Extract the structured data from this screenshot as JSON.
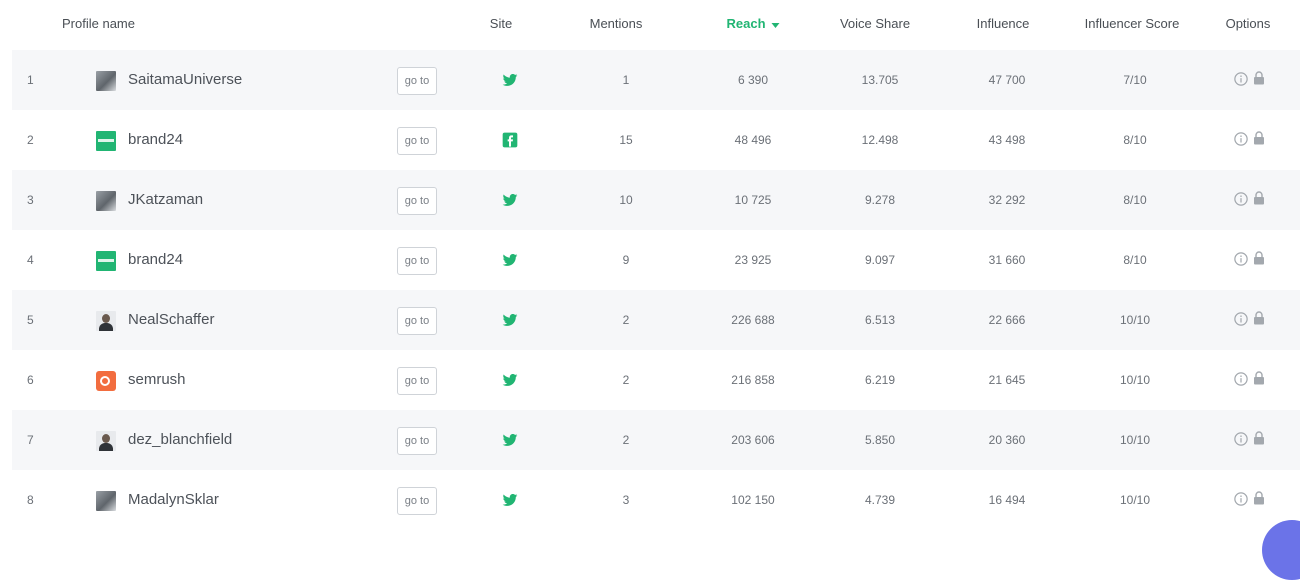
{
  "header": {
    "profile_name": "Profile name",
    "site": "Site",
    "mentions": "Mentions",
    "reach": "Reach",
    "voice_share": "Voice Share",
    "influence": "Influence",
    "influencer_score": "Influencer Score",
    "options": "Options"
  },
  "sorted_column": "reach",
  "sort_direction": "descending",
  "colors": {
    "accent": "#21b573",
    "twitter_icon": "#21b573",
    "row_alt": "#f6f7f9"
  },
  "go_to_label": "go to",
  "rows": [
    {
      "index": "1",
      "profile": "SaitamaUniverse",
      "avatar": "photo",
      "site": "twitter-icon",
      "mentions": "1",
      "reach": "6 390",
      "voice_share": "13.705",
      "influence": "47 700",
      "score": "7/10"
    },
    {
      "index": "2",
      "profile": "brand24",
      "avatar": "brand24-logo",
      "site": "facebook-icon",
      "mentions": "15",
      "reach": "48 496",
      "voice_share": "12.498",
      "influence": "43 498",
      "score": "8/10"
    },
    {
      "index": "3",
      "profile": "JKatzaman",
      "avatar": "photo",
      "site": "twitter-icon",
      "mentions": "10",
      "reach": "10 725",
      "voice_share": "9.278",
      "influence": "32 292",
      "score": "8/10"
    },
    {
      "index": "4",
      "profile": "brand24",
      "avatar": "brand24-logo",
      "site": "twitter-icon",
      "mentions": "9",
      "reach": "23 925",
      "voice_share": "9.097",
      "influence": "31 660",
      "score": "8/10"
    },
    {
      "index": "5",
      "profile": "NealSchaffer",
      "avatar": "person",
      "site": "twitter-icon",
      "mentions": "2",
      "reach": "226 688",
      "voice_share": "6.513",
      "influence": "22 666",
      "score": "10/10"
    },
    {
      "index": "6",
      "profile": "semrush",
      "avatar": "semrush-logo",
      "site": "twitter-icon",
      "mentions": "2",
      "reach": "216 858",
      "voice_share": "6.219",
      "influence": "21 645",
      "score": "10/10"
    },
    {
      "index": "7",
      "profile": "dez_blanchfield",
      "avatar": "person",
      "site": "twitter-icon",
      "mentions": "2",
      "reach": "203 606",
      "voice_share": "5.850",
      "influence": "20 360",
      "score": "10/10"
    },
    {
      "index": "8",
      "profile": "MadalynSklar",
      "avatar": "photo",
      "site": "twitter-icon",
      "mentions": "3",
      "reach": "102 150",
      "voice_share": "4.739",
      "influence": "16 494",
      "score": "10/10"
    }
  ]
}
